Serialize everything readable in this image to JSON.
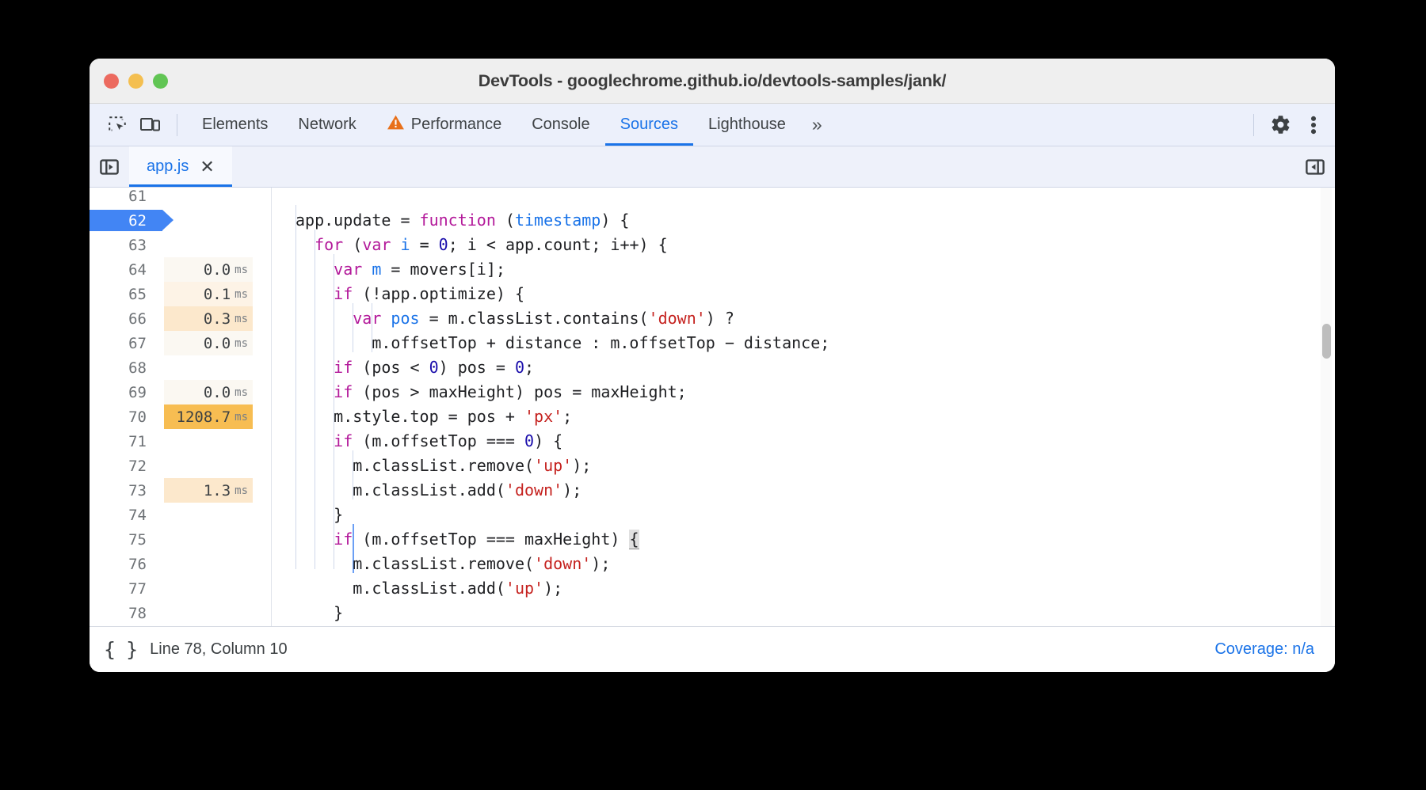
{
  "window": {
    "title": "DevTools - googlechrome.github.io/devtools-samples/jank/",
    "traffic_lights": [
      "close-red",
      "minimize-yellow",
      "maximize-green"
    ]
  },
  "toolbar": {
    "inspect_icon": "inspect-element-icon",
    "device_icon": "device-toolbar-icon",
    "tabs": [
      {
        "label": "Elements",
        "active": false,
        "warning": false
      },
      {
        "label": "Network",
        "active": false,
        "warning": false
      },
      {
        "label": "Performance",
        "active": false,
        "warning": true
      },
      {
        "label": "Console",
        "active": false,
        "warning": false
      },
      {
        "label": "Sources",
        "active": true,
        "warning": false
      },
      {
        "label": "Lighthouse",
        "active": false,
        "warning": false
      }
    ],
    "more_tabs": "»",
    "settings_icon": "gear-icon",
    "menu_icon": "three-dot-menu-icon"
  },
  "file_strip": {
    "navigator_toggle_icon": "show-navigator-icon",
    "sidebar_toggle_icon": "show-debugger-sidebar-icon",
    "tabs": [
      {
        "name": "app.js",
        "close": "✕",
        "active": true
      }
    ]
  },
  "accent": {
    "blue": "#1a73e8",
    "exec_line": "#4285f4",
    "perf_hot": "#f7bd52",
    "perf_warm": "#fce8cc",
    "perf_light": "#fdf3e6",
    "perf_faint": "#fbf8f2"
  },
  "editor": {
    "lines": [
      {
        "num": "61",
        "perf": null,
        "perf_unit": null,
        "current": false,
        "tokens": []
      },
      {
        "num": "62",
        "perf": null,
        "perf_unit": null,
        "current": true,
        "tokens": [
          {
            "t": "app.update = ",
            "c": ""
          },
          {
            "t": "function",
            "c": "def"
          },
          {
            "t": " (",
            "c": ""
          },
          {
            "t": "timestamp",
            "c": "param"
          },
          {
            "t": ") {",
            "c": ""
          }
        ]
      },
      {
        "num": "63",
        "perf": null,
        "perf_unit": null,
        "current": false,
        "tokens": [
          {
            "t": "  ",
            "c": ""
          },
          {
            "t": "for",
            "c": "kw2"
          },
          {
            "t": " (",
            "c": ""
          },
          {
            "t": "var",
            "c": "kw2"
          },
          {
            "t": " ",
            "c": ""
          },
          {
            "t": "i",
            "c": "param"
          },
          {
            "t": " = ",
            "c": ""
          },
          {
            "t": "0",
            "c": "num"
          },
          {
            "t": "; i < app.count; i++) {",
            "c": ""
          }
        ]
      },
      {
        "num": "64",
        "perf": "0.0",
        "perf_unit": "ms",
        "perf_level": "faint",
        "current": false,
        "tokens": [
          {
            "t": "    ",
            "c": ""
          },
          {
            "t": "var",
            "c": "kw2"
          },
          {
            "t": " ",
            "c": ""
          },
          {
            "t": "m",
            "c": "param"
          },
          {
            "t": " = movers[i];",
            "c": ""
          }
        ]
      },
      {
        "num": "65",
        "perf": "0.1",
        "perf_unit": "ms",
        "perf_level": "light",
        "current": false,
        "tokens": [
          {
            "t": "    ",
            "c": ""
          },
          {
            "t": "if",
            "c": "kw2"
          },
          {
            "t": " (!app.optimize) {",
            "c": ""
          }
        ]
      },
      {
        "num": "66",
        "perf": "0.3",
        "perf_unit": "ms",
        "perf_level": "warm",
        "current": false,
        "tokens": [
          {
            "t": "      ",
            "c": ""
          },
          {
            "t": "var",
            "c": "kw2"
          },
          {
            "t": " ",
            "c": ""
          },
          {
            "t": "pos",
            "c": "param"
          },
          {
            "t": " = m.classList.contains(",
            "c": ""
          },
          {
            "t": "'down'",
            "c": "str"
          },
          {
            "t": ") ?",
            "c": ""
          }
        ]
      },
      {
        "num": "67",
        "perf": "0.0",
        "perf_unit": "ms",
        "perf_level": "faint",
        "current": false,
        "tokens": [
          {
            "t": "        m.offsetTop + distance : m.offsetTop − distance;",
            "c": ""
          }
        ]
      },
      {
        "num": "68",
        "perf": null,
        "perf_unit": null,
        "current": false,
        "tokens": [
          {
            "t": "    ",
            "c": ""
          },
          {
            "t": "if",
            "c": "kw2"
          },
          {
            "t": " (pos < ",
            "c": ""
          },
          {
            "t": "0",
            "c": "num"
          },
          {
            "t": ") pos = ",
            "c": ""
          },
          {
            "t": "0",
            "c": "num"
          },
          {
            "t": ";",
            "c": ""
          }
        ]
      },
      {
        "num": "69",
        "perf": "0.0",
        "perf_unit": "ms",
        "perf_level": "faint",
        "current": false,
        "tokens": [
          {
            "t": "    ",
            "c": ""
          },
          {
            "t": "if",
            "c": "kw2"
          },
          {
            "t": " (pos > maxHeight) pos = maxHeight;",
            "c": ""
          }
        ]
      },
      {
        "num": "70",
        "perf": "1208.7",
        "perf_unit": "ms",
        "perf_level": "hot",
        "current": false,
        "tokens": [
          {
            "t": "    m.style.top = pos + ",
            "c": ""
          },
          {
            "t": "'px'",
            "c": "str"
          },
          {
            "t": ";",
            "c": ""
          }
        ]
      },
      {
        "num": "71",
        "perf": null,
        "perf_unit": null,
        "current": false,
        "tokens": [
          {
            "t": "    ",
            "c": ""
          },
          {
            "t": "if",
            "c": "kw2"
          },
          {
            "t": " (m.offsetTop === ",
            "c": ""
          },
          {
            "t": "0",
            "c": "num"
          },
          {
            "t": ") {",
            "c": ""
          }
        ]
      },
      {
        "num": "72",
        "perf": null,
        "perf_unit": null,
        "current": false,
        "tokens": [
          {
            "t": "      m.classList.remove(",
            "c": ""
          },
          {
            "t": "'up'",
            "c": "str"
          },
          {
            "t": ");",
            "c": ""
          }
        ]
      },
      {
        "num": "73",
        "perf": "1.3",
        "perf_unit": "ms",
        "perf_level": "warm",
        "current": false,
        "tokens": [
          {
            "t": "      m.classList.add(",
            "c": ""
          },
          {
            "t": "'down'",
            "c": "str"
          },
          {
            "t": ");",
            "c": ""
          }
        ]
      },
      {
        "num": "74",
        "perf": null,
        "perf_unit": null,
        "current": false,
        "tokens": [
          {
            "t": "    }",
            "c": ""
          }
        ]
      },
      {
        "num": "75",
        "perf": null,
        "perf_unit": null,
        "current": false,
        "tokens": [
          {
            "t": "    ",
            "c": ""
          },
          {
            "t": "if",
            "c": "kw2"
          },
          {
            "t": " (m.offsetTop === maxHeight) ",
            "c": ""
          },
          {
            "t": "{",
            "c": "brace-hl"
          }
        ]
      },
      {
        "num": "76",
        "perf": null,
        "perf_unit": null,
        "current": false,
        "tokens": [
          {
            "t": "      m.classList.remove(",
            "c": ""
          },
          {
            "t": "'down'",
            "c": "str"
          },
          {
            "t": ");",
            "c": ""
          }
        ]
      },
      {
        "num": "77",
        "perf": null,
        "perf_unit": null,
        "current": false,
        "tokens": [
          {
            "t": "      m.classList.add(",
            "c": ""
          },
          {
            "t": "'up'",
            "c": "str"
          },
          {
            "t": ");",
            "c": ""
          }
        ]
      },
      {
        "num": "78",
        "perf": null,
        "perf_unit": null,
        "current": false,
        "tokens": [
          {
            "t": "    }",
            "c": ""
          }
        ]
      }
    ]
  },
  "statusbar": {
    "pretty_print_icon": "pretty-print-braces-icon",
    "pretty_print_label": "{ }",
    "cursor_position": "Line 78, Column 10",
    "coverage": "Coverage: n/a"
  }
}
